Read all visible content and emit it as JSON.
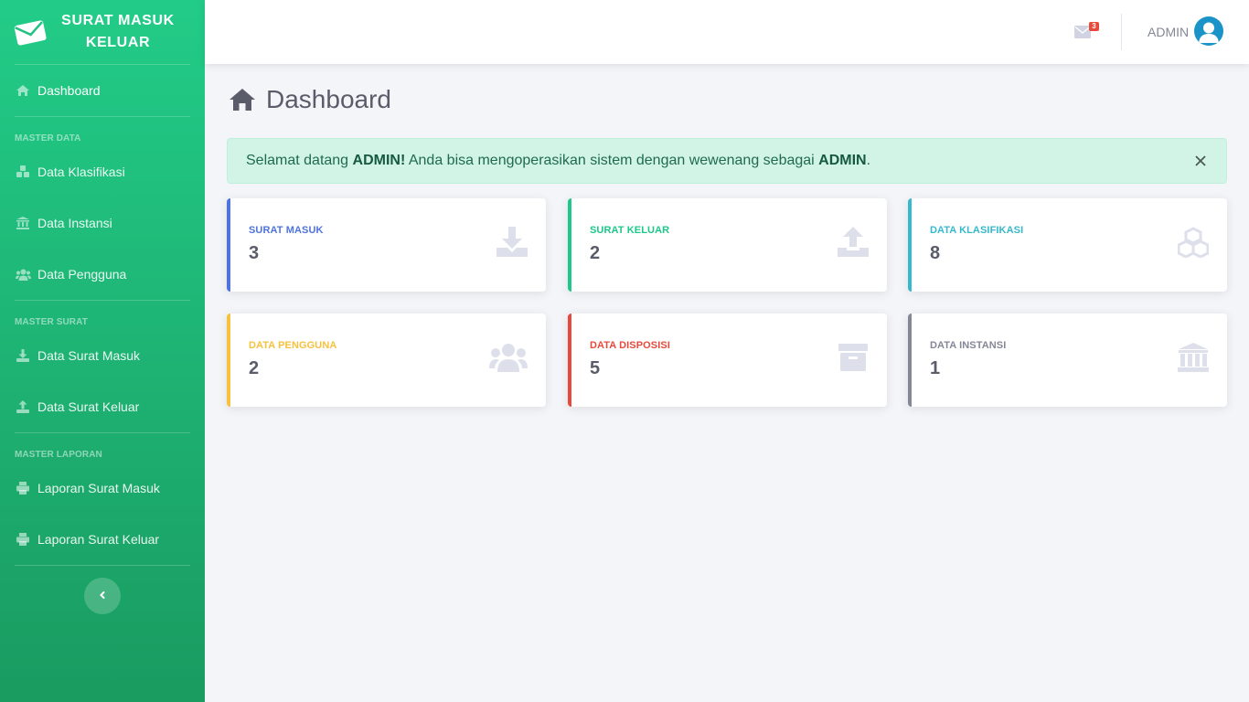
{
  "app": {
    "title_line1": "SURAT MASUK",
    "title_line2": "KELUAR"
  },
  "sidebar": {
    "dashboard": {
      "label": "Dashboard",
      "icon": "home-icon"
    },
    "sections": [
      {
        "heading": "MASTER DATA"
      },
      {
        "heading": "MASTER SURAT"
      },
      {
        "heading": "MASTER LAPORAN"
      }
    ],
    "items": [
      {
        "label": "Data Klasifikasi",
        "icon": "cubes-icon"
      },
      {
        "label": "Data Instansi",
        "icon": "university-icon"
      },
      {
        "label": "Data Pengguna",
        "icon": "users-icon"
      },
      {
        "label": "Data Surat Masuk",
        "icon": "download-icon"
      },
      {
        "label": "Data Surat Keluar",
        "icon": "upload-icon"
      },
      {
        "label": "Laporan Surat Masuk",
        "icon": "print-icon"
      },
      {
        "label": "Laporan Surat Keluar",
        "icon": "print-icon"
      }
    ],
    "toggle_icon": "chevron-left-icon"
  },
  "topbar": {
    "mail_badge": "3",
    "user_name": "ADMIN"
  },
  "page": {
    "title": "Dashboard"
  },
  "alert": {
    "prefix": "Selamat datang ",
    "name": "ADMIN!",
    "middle": " Anda bisa mengoperasikan sistem dengan wewenang sebagai ",
    "role": "ADMIN",
    "suffix": "."
  },
  "cards": [
    {
      "label": "SURAT MASUK",
      "value": "3",
      "color": "#4e73df",
      "icon": "download-icon"
    },
    {
      "label": "SURAT KELUAR",
      "value": "2",
      "color": "#1cc88a",
      "icon": "upload-icon"
    },
    {
      "label": "DATA KLASIFIKASI",
      "value": "8",
      "color": "#36b9cc",
      "icon": "cubes-icon"
    },
    {
      "label": "DATA PENGGUNA",
      "value": "2",
      "color": "#f6c23e",
      "icon": "users-icon"
    },
    {
      "label": "DATA DISPOSISI",
      "value": "5",
      "color": "#e74a3b",
      "icon": "archive-icon"
    },
    {
      "label": "DATA INSTANSI",
      "value": "1",
      "color": "#858796",
      "icon": "university-icon"
    }
  ]
}
